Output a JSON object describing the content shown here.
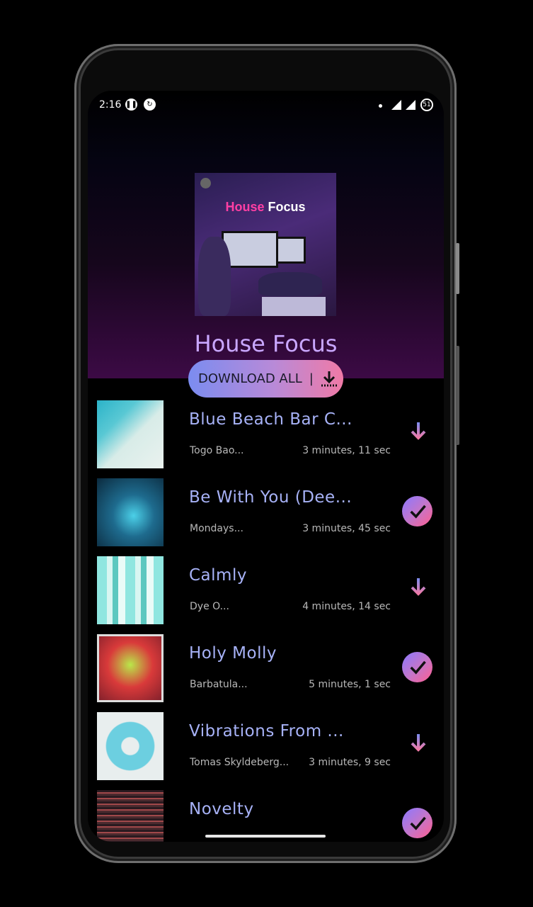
{
  "status_bar": {
    "time": "2:16",
    "battery_text": "51"
  },
  "playlist": {
    "cover_text_prefix": "House",
    "cover_text_suffix": "Focus",
    "title": "House Focus"
  },
  "download_all": {
    "label": "DOWNLOAD ALL",
    "separator": "|"
  },
  "tracks": [
    {
      "title": "Blue Beach Bar C...",
      "artist": "Togo Bao...",
      "duration": "3 minutes, 11 sec",
      "state": "download"
    },
    {
      "title": "Be With You (Dee...",
      "artist": "Mondays...",
      "duration": "3 minutes, 45 sec",
      "state": "downloaded"
    },
    {
      "title": "Calmly",
      "artist": "Dye O...",
      "duration": "4 minutes, 14 sec",
      "state": "download"
    },
    {
      "title": "Holy Molly",
      "artist": "Barbatula...",
      "duration": "5 minutes, 1 sec",
      "state": "downloaded"
    },
    {
      "title": "Vibrations From ...",
      "artist": "Tomas Skyldeberg...",
      "duration": "3 minutes, 9 sec",
      "state": "download"
    },
    {
      "title": "Novelty",
      "artist": "",
      "duration": "",
      "state": "downloaded"
    }
  ],
  "colors": {
    "accent_start": "#7b8cf0",
    "accent_end": "#f07aa6",
    "title_text": "#a7b2f7",
    "playlist_title": "#c9a7ff"
  }
}
